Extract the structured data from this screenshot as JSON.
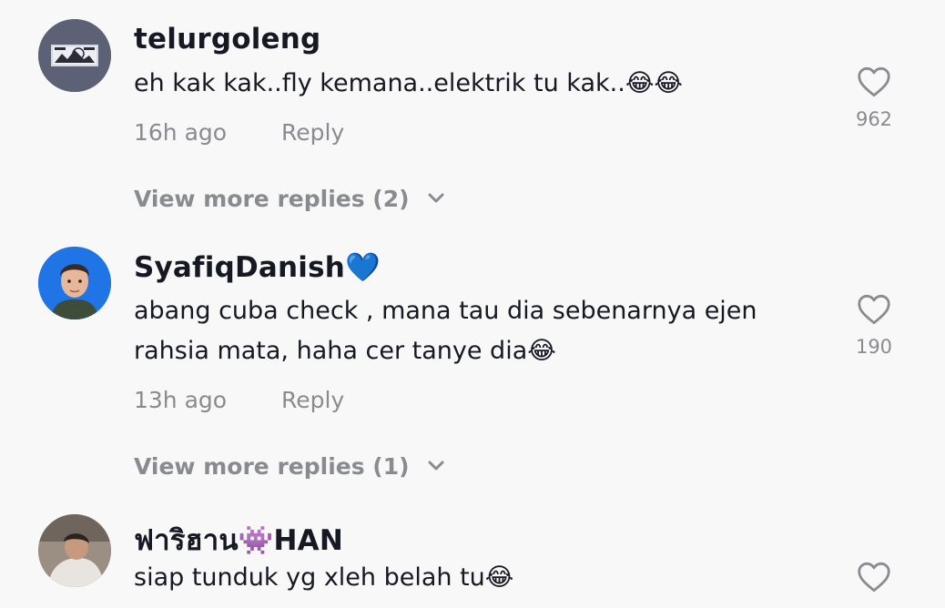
{
  "comments": [
    {
      "username": "telurgoleng",
      "text": "eh kak kak..fly kemana..elektrik tu kak..😂😂",
      "time": "16h ago",
      "reply": "Reply",
      "likes": "962",
      "view_more": "View more replies (2)",
      "avatar_icon": "landscape-sketch-avatar"
    },
    {
      "username": "SyafiqDanish💙",
      "text": "abang cuba check , mana tau dia sebenarnya ejen rahsia mata, haha cer tanye dia😂",
      "time": "13h ago",
      "reply": "Reply",
      "likes": "190",
      "view_more": "View more replies (1)",
      "avatar_icon": "person-portrait-avatar"
    },
    {
      "username": "ฟาริฮาน👾HAN",
      "text": "siap tunduk yg xleh belah tu😂",
      "avatar_icon": "photo-avatar"
    }
  ],
  "colors": {
    "background": "#f8f8f8",
    "primary_text": "#161823",
    "secondary_text": "#8a8b91"
  }
}
